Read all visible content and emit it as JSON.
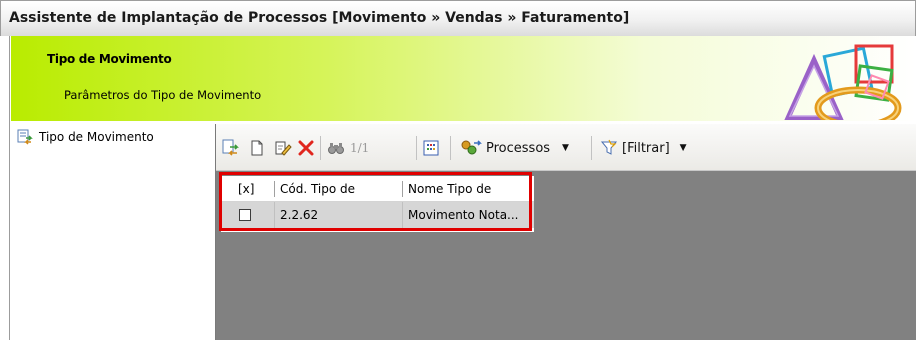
{
  "window": {
    "title": "Assistente de Implantação de Processos [Movimento » Vendas » Faturamento]"
  },
  "banner": {
    "title": "Tipo de Movimento",
    "subtitle": "Parâmetros do Tipo de Movimento",
    "logo": "colorful-shapes-logo"
  },
  "tree": {
    "items": [
      {
        "label": "Tipo de Movimento",
        "icon": "document-exchange-icon"
      }
    ]
  },
  "toolbar": {
    "record_counter": "1/1",
    "processos_label": "Processos",
    "filtrar_label": "[Filtrar]",
    "icons": [
      "refresh-icon",
      "new-document-icon",
      "edit-icon",
      "delete-icon",
      "find-icon",
      "grid-view-icon",
      "processos-icon",
      "filter-icon"
    ]
  },
  "grid": {
    "columns": [
      "[x]",
      "Cód. Tipo de",
      "Nome Tipo de"
    ],
    "rows": [
      {
        "checked": false,
        "codigo": "2.2.62",
        "nome": "Movimento Nota..."
      }
    ]
  },
  "colors": {
    "highlight": "#e00000",
    "banner_accent": "#b9ec00",
    "pane_gray": "#818181"
  }
}
